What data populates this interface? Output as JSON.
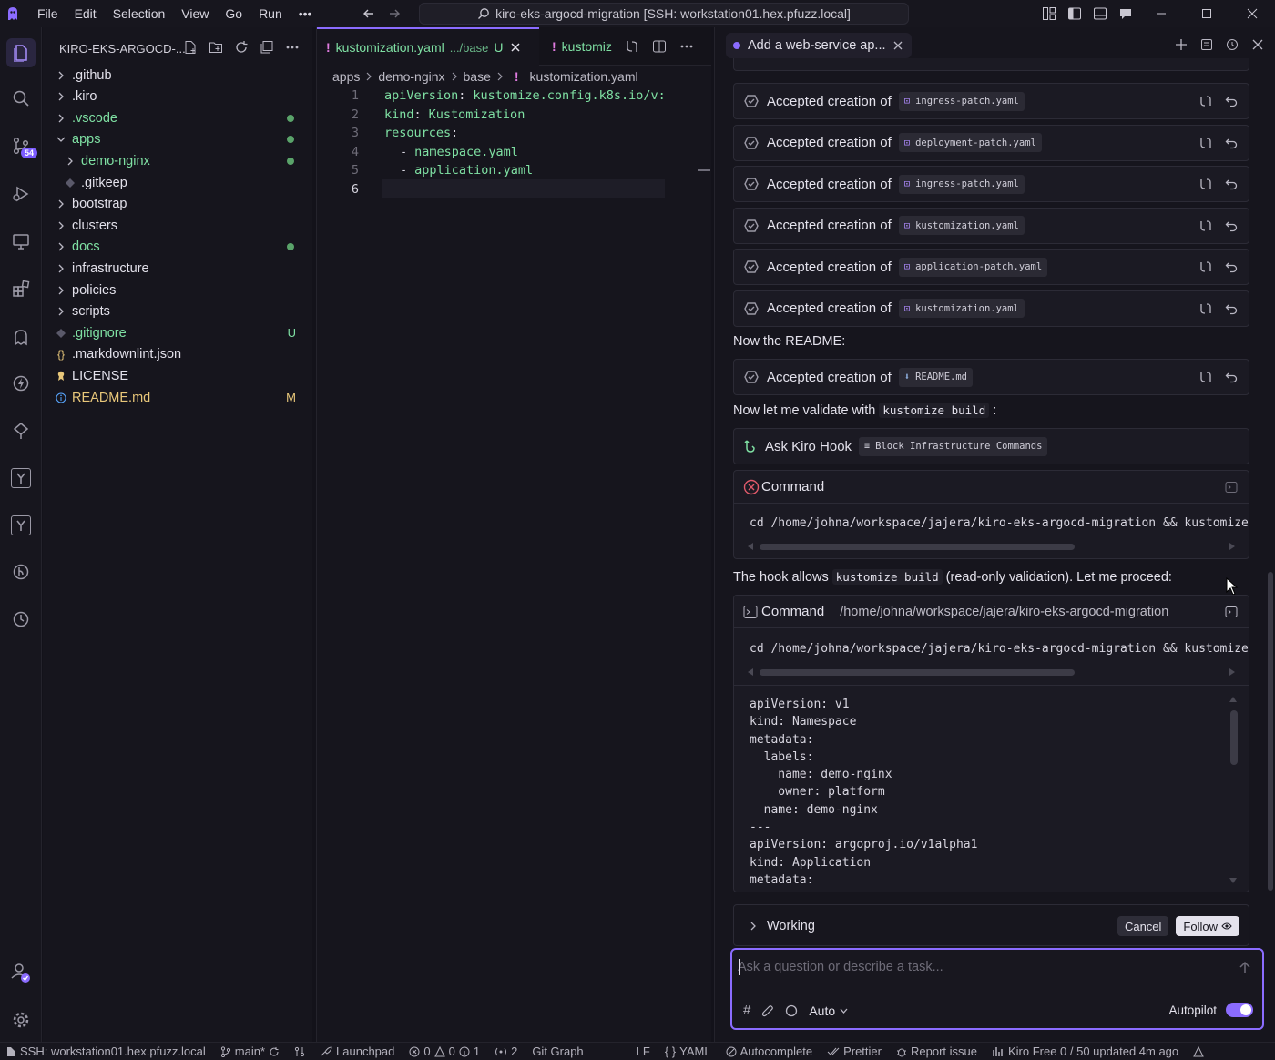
{
  "menu": [
    "File",
    "Edit",
    "Selection",
    "View",
    "Go",
    "Run",
    "•••"
  ],
  "command_center": "kiro-eks-argocd-migration [SSH: workstation01.hex.pfuzz.local]",
  "activity": {
    "scm_badge": "54"
  },
  "sidebar": {
    "title": "KIRO-EKS-ARGOCD-...",
    "tree": [
      {
        "label": ".github",
        "type": "folder",
        "indent": 1,
        "color": "#e2e0ea",
        "status": ""
      },
      {
        "label": ".kiro",
        "type": "folder",
        "indent": 1,
        "color": "#e2e0ea",
        "status": ""
      },
      {
        "label": ".vscode",
        "type": "folder",
        "indent": 1,
        "color": "#7fe0a3",
        "status": "dot"
      },
      {
        "label": "apps",
        "type": "folder-open",
        "indent": 1,
        "color": "#7fe0a3",
        "status": "dot"
      },
      {
        "label": "demo-nginx",
        "type": "folder",
        "indent": 2,
        "color": "#7fe0a3",
        "status": "dot"
      },
      {
        "label": ".gitkeep",
        "type": "file",
        "indent": 2,
        "color": "#e2e0ea",
        "status": ""
      },
      {
        "label": "bootstrap",
        "type": "folder",
        "indent": 1,
        "color": "#e2e0ea",
        "status": ""
      },
      {
        "label": "clusters",
        "type": "folder",
        "indent": 1,
        "color": "#e2e0ea",
        "status": ""
      },
      {
        "label": "docs",
        "type": "folder",
        "indent": 1,
        "color": "#7fe0a3",
        "status": "dot"
      },
      {
        "label": "infrastructure",
        "type": "folder",
        "indent": 1,
        "color": "#e2e0ea",
        "status": ""
      },
      {
        "label": "policies",
        "type": "folder",
        "indent": 1,
        "color": "#e2e0ea",
        "status": ""
      },
      {
        "label": "scripts",
        "type": "folder",
        "indent": 1,
        "color": "#e2e0ea",
        "status": ""
      },
      {
        "label": ".gitignore",
        "type": "file",
        "indent": 1,
        "color": "#7fe0a3",
        "status": "U"
      },
      {
        "label": ".markdownlint.json",
        "type": "json",
        "indent": 1,
        "color": "#e2e0ea",
        "status": ""
      },
      {
        "label": "LICENSE",
        "type": "license",
        "indent": 1,
        "color": "#e2e0ea",
        "status": ""
      },
      {
        "label": "README.md",
        "type": "info",
        "indent": 1,
        "color": "#e8c77a",
        "status": "M"
      }
    ]
  },
  "editor": {
    "tabs": [
      {
        "name": "kustomization.yaml",
        "desc": ".../base",
        "status": "U"
      },
      {
        "name": "kustomiz",
        "desc": "",
        "status": ""
      }
    ],
    "breadcrumb": [
      "apps",
      "demo-nginx",
      "base",
      "kustomization.yaml"
    ],
    "lines": [
      {
        "n": "1",
        "k": "apiVersion",
        "v": "kustomize.config.k8s.io/v:",
        "dash": false
      },
      {
        "n": "2",
        "k": "kind",
        "v": "Kustomization",
        "dash": false
      },
      {
        "n": "3",
        "k": "resources",
        "v": "",
        "dash": false
      },
      {
        "n": "4",
        "k": "",
        "v": "namespace.yaml",
        "dash": true
      },
      {
        "n": "5",
        "k": "",
        "v": "application.yaml",
        "dash": true
      },
      {
        "n": "6",
        "k": "",
        "v": "",
        "dash": false
      }
    ]
  },
  "chat": {
    "tab_title": "Add a web-service ap...",
    "accepted_label": "Accepted creation of",
    "accepted": [
      "ingress-patch.yaml",
      "deployment-patch.yaml",
      "ingress-patch.yaml",
      "kustomization.yaml",
      "application-patch.yaml",
      "kustomization.yaml"
    ],
    "readme_note": "Now the README:",
    "readme_file": "README.md",
    "validate_pre": "Now let me validate with",
    "validate_code": "kustomize build",
    "validate_post": ":",
    "hook_label": "Ask Kiro Hook",
    "hook_chip": "Block Infrastructure Commands",
    "command_label": "Command",
    "command_text": "cd /home/johna/workspace/jajera/kiro-eks-argocd-migration && kustomize",
    "hook_pre": "The hook allows",
    "hook_code": "kustomize build",
    "hook_post": "(read-only validation). Let me proceed:",
    "command2_label": "Command",
    "command2_path": "/home/johna/workspace/jajera/kiro-eks-argocd-migration",
    "command2_text": "cd /home/johna/workspace/jajera/kiro-eks-argocd-migration && kustomize",
    "output": [
      "apiVersion: v1",
      "kind: Namespace",
      "metadata:",
      "  labels:",
      "    name: demo-nginx",
      "    owner: platform",
      "  name: demo-nginx",
      "---",
      "apiVersion: argoproj.io/v1alpha1",
      "kind: Application",
      "metadata:"
    ],
    "working": "Working",
    "cancel": "Cancel",
    "follow": "Follow",
    "input_placeholder": "Ask a question or describe a task...",
    "mode": "Auto",
    "autopilot": "Autopilot",
    "autopilot_on": true
  },
  "status": {
    "remote": "SSH: workstation01.hex.pfuzz.local",
    "branch": "main*",
    "launchpad": "Launchpad",
    "errors": "0",
    "warnings": "0",
    "infos": "1",
    "ports": "2",
    "gitgraph": "Git Graph",
    "eol": "LF",
    "lang": "YAML",
    "autocomplete": "Autocomplete",
    "prettier": "Prettier",
    "report": "Report issue",
    "plan": "Kiro Free 0 / 50 updated 4m ago"
  },
  "colors": {
    "accent": "#8b6cff",
    "green": "#7fe0a3",
    "modified": "#e8c77a",
    "error": "#e05a6a"
  }
}
